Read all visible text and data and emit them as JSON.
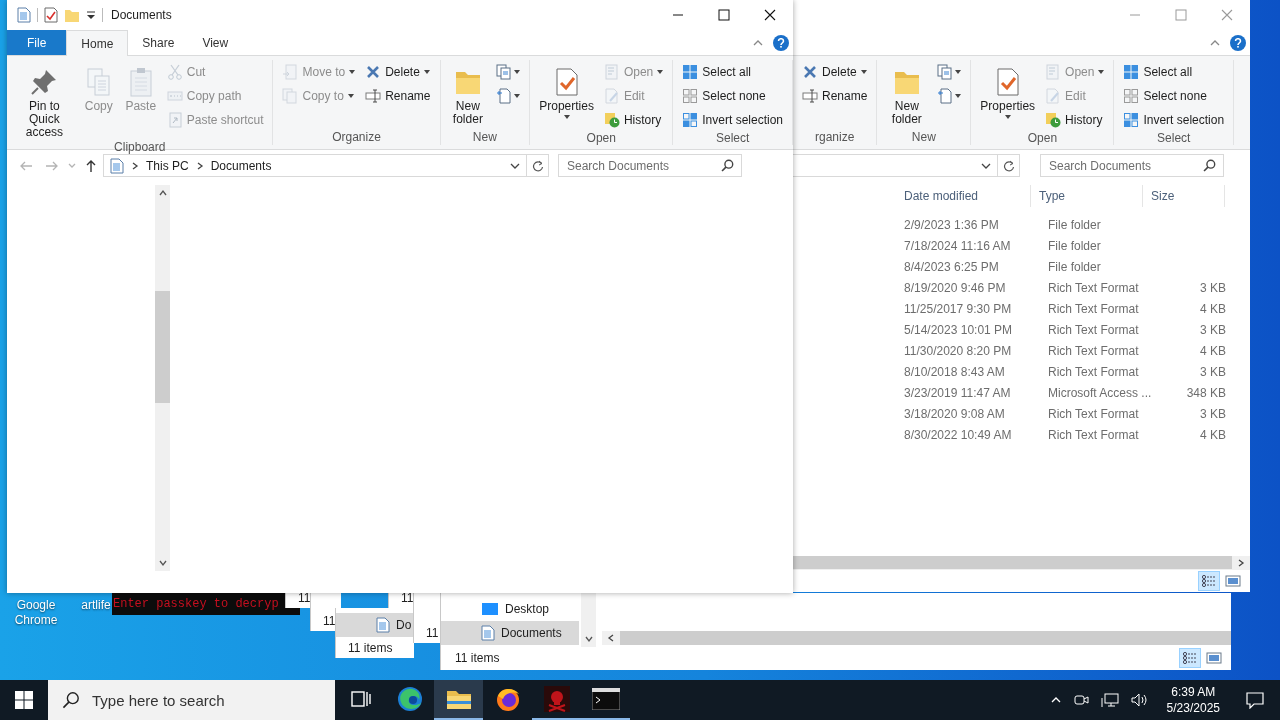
{
  "desktop_icons": [
    {
      "label": "Google Chrome"
    },
    {
      "label": "artlife"
    }
  ],
  "background_windows": [
    {
      "kind": "console",
      "text": "Enter passkey to decryp"
    },
    {
      "kind": "explorer",
      "status": "11"
    },
    {
      "kind": "explorer",
      "status": "11"
    },
    {
      "kind": "explorer",
      "status": "11"
    },
    {
      "kind": "explorer",
      "nav_items": [
        {
          "label": "Do",
          "selected": true
        }
      ],
      "status": "11 items"
    },
    {
      "kind": "explorer",
      "status": "11"
    },
    {
      "kind": "explorer",
      "nav_items": [
        {
          "label": "Desktop",
          "selected": false
        },
        {
          "label": "Documents",
          "selected": true
        }
      ],
      "status": "11 items",
      "views": [
        {
          "selected": true
        },
        {
          "selected": false
        }
      ]
    }
  ],
  "back_window": {
    "active": false,
    "ribbon": [
      {
        "label": "rganize",
        "columns": [
          [
            {
              "label": "Delete",
              "kind": "small",
              "disabled": false,
              "dropdown": true
            },
            {
              "label": "Rename",
              "kind": "small",
              "disabled": false,
              "dropdown": false
            }
          ]
        ]
      },
      {
        "label": "New",
        "columns": [
          [
            {
              "label": "New folder",
              "kind": "large",
              "disabled": false,
              "dropdown": false
            }
          ],
          [
            {
              "kind": "icon",
              "disabled": false,
              "dropdown": true
            },
            {
              "kind": "icon",
              "disabled": false,
              "dropdown": true
            }
          ]
        ]
      },
      {
        "label": "Open",
        "columns": [
          [
            {
              "label": "Properties",
              "kind": "large",
              "disabled": false,
              "dropdown": true
            }
          ],
          [
            {
              "label": "Open",
              "kind": "small",
              "disabled": true,
              "dropdown": true
            },
            {
              "label": "Edit",
              "kind": "small",
              "disabled": true,
              "dropdown": false
            },
            {
              "label": "History",
              "kind": "small",
              "disabled": false,
              "dropdown": false
            }
          ]
        ]
      },
      {
        "label": "Select",
        "columns": [
          [
            {
              "label": "Select all",
              "kind": "small",
              "disabled": false,
              "dropdown": false
            },
            {
              "label": "Select none",
              "kind": "small",
              "disabled": false,
              "dropdown": false
            },
            {
              "label": "Invert selection",
              "kind": "small",
              "disabled": false,
              "dropdown": false
            }
          ]
        ]
      }
    ],
    "search": {
      "placeholder": "Search Documents"
    },
    "columns": [
      "Date modified",
      "Type",
      "Size"
    ],
    "rows": [
      {
        "date": "2/9/2023 1:36 PM",
        "type": "File folder"
      },
      {
        "date": "7/18/2024 11:16 AM",
        "type": "File folder"
      },
      {
        "date": "8/4/2023 6:25 PM",
        "type": "File folder"
      },
      {
        "date": "8/19/2020 9:46 PM",
        "type": "Rich Text Format",
        "size": "3 KB"
      },
      {
        "date": "11/25/2017 9:30 PM",
        "type": "Rich Text Format",
        "size": "4 KB"
      },
      {
        "date": "5/14/2023 10:01 PM",
        "type": "Rich Text Format",
        "size": "3 KB"
      },
      {
        "date": "11/30/2020 8:20 PM",
        "type": "Rich Text Format",
        "size": "4 KB"
      },
      {
        "date": "8/10/2018 8:43 AM",
        "type": "Rich Text Format",
        "size": "3 KB"
      },
      {
        "date": "3/23/2019 11:47 AM",
        "type": "Microsoft Access ...",
        "size": "348 KB"
      },
      {
        "date": "3/18/2020 9:08 AM",
        "type": "Rich Text Format",
        "size": "3 KB"
      },
      {
        "date": "8/30/2022 10:49 AM",
        "type": "Rich Text Format",
        "size": "4 KB"
      }
    ],
    "views": [
      {
        "selected": true
      },
      {
        "selected": false
      }
    ]
  },
  "front_window": {
    "active": true,
    "title": "Documents",
    "tabs": [
      {
        "label": "File",
        "kind": "file",
        "selected": false
      },
      {
        "label": "Home",
        "kind": "tab",
        "selected": true
      },
      {
        "label": "Share",
        "kind": "tab",
        "selected": false
      },
      {
        "label": "View",
        "kind": "tab",
        "selected": false
      }
    ],
    "ribbon": [
      {
        "label": "Clipboard",
        "columns": [
          [
            {
              "label": "Pin to Quick access",
              "kind": "large",
              "disabled": false,
              "dropdown": false
            }
          ],
          [
            {
              "label": "Copy",
              "kind": "large",
              "disabled": true,
              "dropdown": false
            }
          ],
          [
            {
              "label": "Paste",
              "kind": "large",
              "disabled": true,
              "dropdown": false
            }
          ],
          [
            {
              "label": "Cut",
              "kind": "small",
              "disabled": true,
              "dropdown": false
            },
            {
              "label": "Copy path",
              "kind": "small",
              "disabled": true,
              "dropdown": false
            },
            {
              "label": "Paste shortcut",
              "kind": "small",
              "disabled": true,
              "dropdown": false
            }
          ]
        ]
      },
      {
        "label": "Organize",
        "columns": [
          [
            {
              "label": "Move to",
              "kind": "small",
              "disabled": true,
              "dropdown": true
            },
            {
              "label": "Copy to",
              "kind": "small",
              "disabled": true,
              "dropdown": true
            }
          ],
          [
            {
              "label": "Delete",
              "kind": "small",
              "disabled": false,
              "dropdown": true
            },
            {
              "label": "Rename",
              "kind": "small",
              "disabled": false,
              "dropdown": false
            }
          ]
        ]
      },
      {
        "label": "New",
        "columns": [
          [
            {
              "label": "New folder",
              "kind": "large",
              "disabled": false,
              "dropdown": false
            }
          ],
          [
            {
              "kind": "icon",
              "disabled": false,
              "dropdown": true
            },
            {
              "kind": "icon",
              "disabled": false,
              "dropdown": true
            }
          ]
        ]
      },
      {
        "label": "Open",
        "columns": [
          [
            {
              "label": "Properties",
              "kind": "large",
              "disabled": false,
              "dropdown": true
            }
          ],
          [
            {
              "label": "Open",
              "kind": "small",
              "disabled": true,
              "dropdown": true
            },
            {
              "label": "Edit",
              "kind": "small",
              "disabled": true,
              "dropdown": false
            },
            {
              "label": "History",
              "kind": "small",
              "disabled": false,
              "dropdown": false
            }
          ]
        ]
      },
      {
        "label": "Select",
        "columns": [
          [
            {
              "label": "Select all",
              "kind": "small",
              "disabled": false,
              "dropdown": false
            },
            {
              "label": "Select none",
              "kind": "small",
              "disabled": false,
              "dropdown": false
            },
            {
              "label": "Invert selection",
              "kind": "small",
              "disabled": false,
              "dropdown": false
            }
          ]
        ]
      }
    ],
    "breadcrumb": [
      "This PC",
      "Documents"
    ],
    "search": {
      "placeholder": "Search Documents"
    }
  },
  "taskbar": {
    "search": {
      "placeholder": "Type here to search"
    },
    "apps": [
      {
        "selected": false,
        "running": false
      },
      {
        "selected": true,
        "running": true
      },
      {
        "selected": false,
        "running": false
      },
      {
        "selected": false,
        "running": true
      },
      {
        "selected": false,
        "running": true
      }
    ],
    "clock": {
      "time": "6:39 AM",
      "date": "5/23/2025"
    }
  }
}
